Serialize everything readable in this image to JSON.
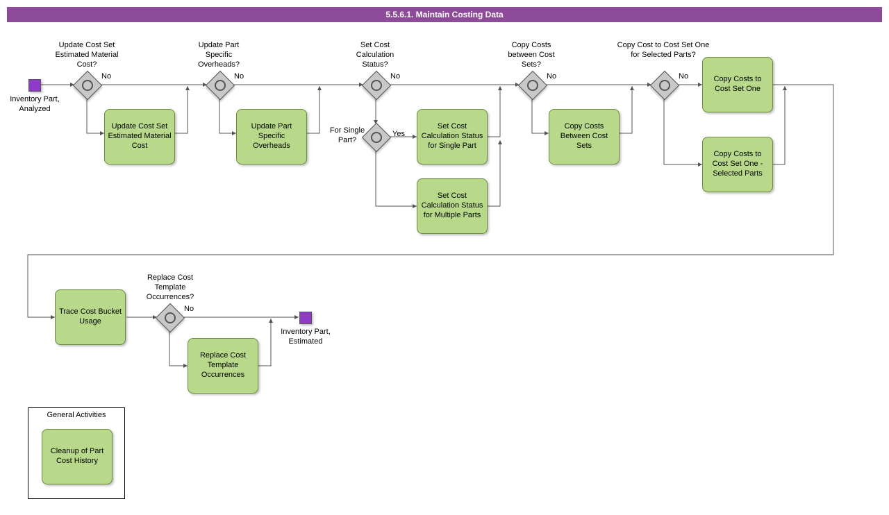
{
  "title": "5.5.6.1. Maintain Costing Data",
  "events": {
    "start_label": "Inventory Part, Analyzed",
    "end_label": "Inventory Part, Estimated"
  },
  "gateways": {
    "g1": {
      "label": "Update Cost Set Estimated Material Cost?",
      "no": "No"
    },
    "g2": {
      "label": "Update Part Specific Overheads?",
      "no": "No"
    },
    "g3": {
      "label": "Set Cost Calculation Status?",
      "no": "No"
    },
    "g4": {
      "label": "For Single Part?",
      "yes": "Yes"
    },
    "g5": {
      "label": "Copy Costs between Cost Sets?",
      "no": "No"
    },
    "g6": {
      "label": "Copy Cost to Cost Set One for Selected Parts?",
      "no": "No"
    },
    "g7": {
      "label": "Replace Cost Template Occurrences?",
      "no": "No"
    }
  },
  "tasks": {
    "t1": "Update Cost Set Estimated Material Cost",
    "t2": "Update Part Specific Overheads",
    "t3": "Set Cost Calculation Status for Single Part",
    "t4": "Set Cost Calculation Status for Multiple Parts",
    "t5": "Copy Costs Between Cost Sets",
    "t6": "Copy Costs to Cost Set One",
    "t7": "Copy Costs to Cost Set One - Selected Parts",
    "t8": "Trace Cost Bucket Usage",
    "t9": "Replace Cost Template Occurrences",
    "t10": "Cleanup of Part Cost History"
  },
  "group": {
    "title": "General Activities"
  },
  "colors": {
    "header_bg": "#8e4b99",
    "task_bg": "#b7d989",
    "event_bg": "#8e3cc7"
  },
  "chart_data": {
    "type": "bpmn-flowchart",
    "title": "5.5.6.1. Maintain Costing Data",
    "start_event": "Inventory Part, Analyzed",
    "end_event": "Inventory Part, Estimated",
    "nodes": [
      {
        "id": "start",
        "type": "start-event",
        "label": "Inventory Part, Analyzed"
      },
      {
        "id": "g1",
        "type": "inclusive-gateway",
        "label": "Update Cost Set Estimated Material Cost?"
      },
      {
        "id": "t1",
        "type": "task",
        "label": "Update Cost Set Estimated Material Cost"
      },
      {
        "id": "g2",
        "type": "inclusive-gateway",
        "label": "Update Part Specific Overheads?"
      },
      {
        "id": "t2",
        "type": "task",
        "label": "Update Part Specific Overheads"
      },
      {
        "id": "g3",
        "type": "inclusive-gateway",
        "label": "Set Cost Calculation Status?"
      },
      {
        "id": "g4",
        "type": "inclusive-gateway",
        "label": "For Single Part?"
      },
      {
        "id": "t3",
        "type": "task",
        "label": "Set Cost Calculation Status for Single Part"
      },
      {
        "id": "t4",
        "type": "task",
        "label": "Set Cost Calculation Status for Multiple Parts"
      },
      {
        "id": "g5",
        "type": "inclusive-gateway",
        "label": "Copy Costs between Cost Sets?"
      },
      {
        "id": "t5",
        "type": "task",
        "label": "Copy Costs Between Cost Sets"
      },
      {
        "id": "g6",
        "type": "inclusive-gateway",
        "label": "Copy Cost to Cost Set One for Selected Parts?"
      },
      {
        "id": "t6",
        "type": "task",
        "label": "Copy Costs to Cost Set One"
      },
      {
        "id": "t7",
        "type": "task",
        "label": "Copy Costs to Cost Set One - Selected Parts"
      },
      {
        "id": "t8",
        "type": "task",
        "label": "Trace Cost Bucket Usage"
      },
      {
        "id": "g7",
        "type": "inclusive-gateway",
        "label": "Replace Cost Template Occurrences?"
      },
      {
        "id": "t9",
        "type": "task",
        "label": "Replace Cost Template Occurrences"
      },
      {
        "id": "end",
        "type": "end-event",
        "label": "Inventory Part, Estimated"
      },
      {
        "id": "t10",
        "type": "task",
        "label": "Cleanup of Part Cost History",
        "group": "General Activities"
      }
    ],
    "edges": [
      {
        "from": "start",
        "to": "g1"
      },
      {
        "from": "g1",
        "to": "g2",
        "label": "No"
      },
      {
        "from": "g1",
        "to": "t1"
      },
      {
        "from": "t1",
        "to": "g2-merge"
      },
      {
        "from": "g2",
        "to": "g3",
        "label": "No"
      },
      {
        "from": "g2",
        "to": "t2"
      },
      {
        "from": "t2",
        "to": "g3-merge"
      },
      {
        "from": "g3",
        "to": "g5",
        "label": "No"
      },
      {
        "from": "g3",
        "to": "g4"
      },
      {
        "from": "g4",
        "to": "t3",
        "label": "Yes"
      },
      {
        "from": "g4",
        "to": "t4"
      },
      {
        "from": "t3",
        "to": "g5-merge"
      },
      {
        "from": "t4",
        "to": "g5-merge"
      },
      {
        "from": "g5",
        "to": "g6",
        "label": "No"
      },
      {
        "from": "g5",
        "to": "t5"
      },
      {
        "from": "t5",
        "to": "g6-merge"
      },
      {
        "from": "g6",
        "to": "t6",
        "label": "No"
      },
      {
        "from": "g6",
        "to": "t7"
      },
      {
        "from": "t6",
        "to": "t8-merge"
      },
      {
        "from": "t7",
        "to": "t8-merge"
      },
      {
        "from": "merge",
        "to": "t8"
      },
      {
        "from": "t8",
        "to": "g7"
      },
      {
        "from": "g7",
        "to": "end",
        "label": "No"
      },
      {
        "from": "g7",
        "to": "t9"
      },
      {
        "from": "t9",
        "to": "end"
      }
    ]
  }
}
